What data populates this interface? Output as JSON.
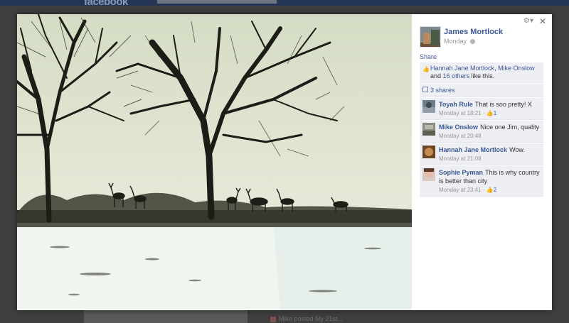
{
  "background": {
    "logo": "facebook",
    "bottom_text": "Mike posted My 21st..."
  },
  "photo": {
    "description_icon": "photo-landscape"
  },
  "author": {
    "name": "James Mortlock",
    "time": "Monday"
  },
  "share_label": "Share",
  "likes": {
    "names": [
      "Hannah Jane Mortlock",
      "Mike Onslow"
    ],
    "and_text": "and",
    "others": "16 others",
    "suffix": "like this."
  },
  "shares": "3 shares",
  "comments": [
    {
      "name": "Toyah Rule",
      "text": "That is soo pretty! X",
      "time": "Monday at 18:21",
      "likes": "1"
    },
    {
      "name": "Mike Onslow",
      "text": "Nice one Jim, quality",
      "time": "Monday at 20:48",
      "likes": ""
    },
    {
      "name": "Hannah Jane Mortlock",
      "text": "Wow.",
      "time": "Monday at 21:08",
      "likes": ""
    },
    {
      "name": "Sophie Pyman",
      "text": "This is why country is better than city",
      "time": "Monday at 23:41",
      "likes": "2"
    }
  ],
  "colors": {
    "link": "#3b5998",
    "panel": "#edeff4"
  }
}
